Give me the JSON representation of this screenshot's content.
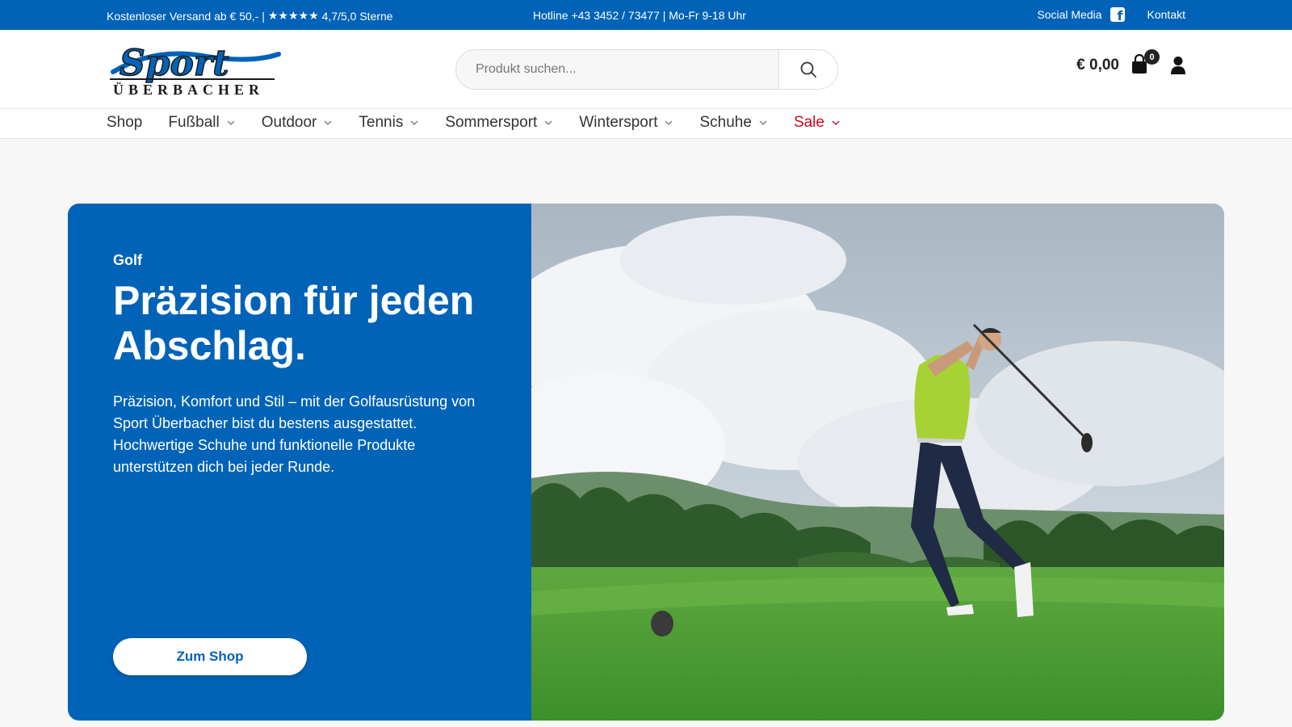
{
  "topbar": {
    "shipping_text": "Kostenloser Versand ab € 50,- |",
    "stars": "★★★★★",
    "rating_text": "4,7/5,0 Sterne",
    "hotline_text": "Hotline +43 3452 / 73477 | Mo-Fr 9-18 Uhr",
    "social_label": "Social Media",
    "contact_label": "Kontakt"
  },
  "header": {
    "logo_top": "Sport",
    "logo_bottom": "ÜBERBACHER",
    "search_placeholder": "Produkt suchen...",
    "cart_total": "€ 0,00",
    "cart_count": "0"
  },
  "nav": {
    "items": [
      {
        "label": "Shop"
      },
      {
        "label": "Fußball"
      },
      {
        "label": "Outdoor"
      },
      {
        "label": "Tennis"
      },
      {
        "label": "Sommersport"
      },
      {
        "label": "Wintersport"
      },
      {
        "label": "Schuhe"
      },
      {
        "label": "Sale"
      }
    ]
  },
  "hero": {
    "kicker": "Golf",
    "title": "Präzision für jeden Abschlag.",
    "text": "Präzision, Komfort und Stil – mit der Golfausrüstung von Sport Überbacher bist du bestens ausgestattet. Hochwertige Schuhe und funktionelle Produkte unterstützen dich bei jeder Runde.",
    "button_label": "Zum Shop"
  },
  "colors": {
    "brand_blue": "#0063b7",
    "sale_red": "#d0021b",
    "white": "#ffffff"
  },
  "icons": [
    "facebook-icon",
    "search-icon",
    "cart-icon",
    "user-icon",
    "chevron-down-icon"
  ]
}
